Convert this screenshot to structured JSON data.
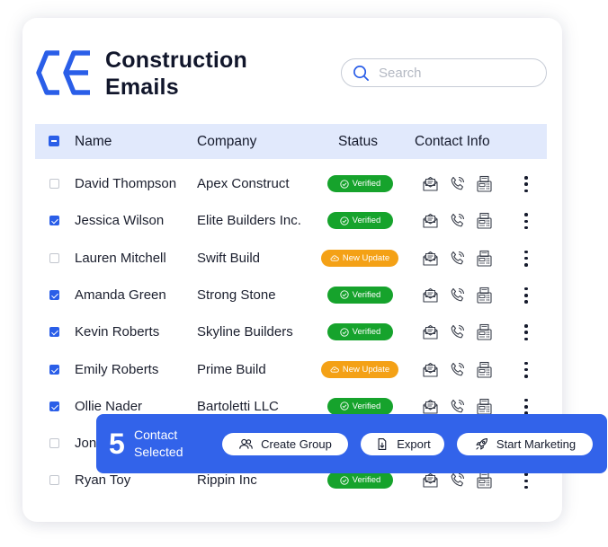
{
  "brand": {
    "line1": "Construction",
    "line2": "Emails"
  },
  "search": {
    "placeholder": "Search"
  },
  "table": {
    "headers": {
      "name": "Name",
      "company": "Company",
      "status": "Status",
      "contact": "Contact Info"
    },
    "rows": [
      {
        "name": "David Thompson",
        "company": "Apex Construct",
        "status": "Verified",
        "checked": false
      },
      {
        "name": "Jessica Wilson",
        "company": "Elite Builders Inc.",
        "status": "Verified",
        "checked": true
      },
      {
        "name": "Lauren Mitchell",
        "company": "Swift Build",
        "status": "New Update",
        "checked": false
      },
      {
        "name": "Amanda Green",
        "company": "Strong Stone",
        "status": "Verified",
        "checked": true
      },
      {
        "name": "Kevin Roberts",
        "company": "Skyline Builders",
        "status": "Verified",
        "checked": true
      },
      {
        "name": "Emily Roberts",
        "company": "Prime Build",
        "status": "New Update",
        "checked": true
      },
      {
        "name": "Ollie Nader",
        "company": "Bartoletti LLC",
        "status": "Verified",
        "checked": true
      },
      {
        "name": "Jon",
        "company": "",
        "status": "",
        "checked": false
      },
      {
        "name": "Ryan Toy",
        "company": "Rippin Inc",
        "status": "Verified",
        "checked": false
      }
    ]
  },
  "selection_bar": {
    "count": "5",
    "label_line1": "Contact",
    "label_line2": "Selected",
    "create_group": "Create Group",
    "export": "Export",
    "start_marketing": "Start Marketing"
  },
  "icons": {
    "logo": "ce-logo-icon",
    "search": "search-icon",
    "mail": "mail-icon",
    "phone": "phone-icon",
    "fax": "fax-icon",
    "more": "kebab-menu-icon",
    "verified": "check-circle-icon",
    "update": "cloud-sync-icon",
    "group": "users-icon",
    "export": "download-icon",
    "marketing": "rocket-icon"
  },
  "colors": {
    "accent": "#3263ea",
    "header_bg": "#e1e9fc",
    "verified": "#16a32c",
    "update": "#f4a116"
  }
}
